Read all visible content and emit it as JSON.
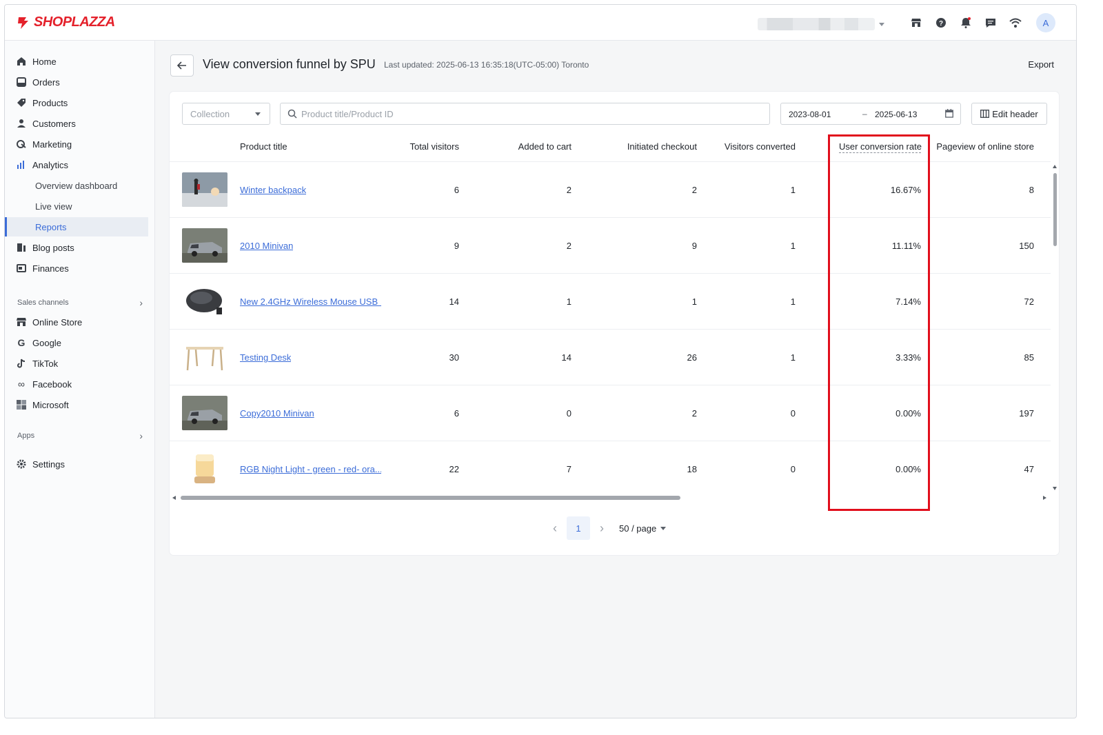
{
  "brand": {
    "name": "SHOPLAZZA",
    "color": "#e4212b"
  },
  "topbar": {
    "icons": [
      "store-icon",
      "help-icon",
      "bell-icon",
      "chat-icon",
      "wifi-icon"
    ],
    "avatar_letter": "A"
  },
  "sidebar": {
    "items": [
      {
        "label": "Home",
        "icon": "home-icon"
      },
      {
        "label": "Orders",
        "icon": "orders-icon"
      },
      {
        "label": "Products",
        "icon": "tag-icon"
      },
      {
        "label": "Customers",
        "icon": "person-icon"
      },
      {
        "label": "Marketing",
        "icon": "marketing-icon"
      },
      {
        "label": "Analytics",
        "icon": "bar-chart-icon"
      }
    ],
    "analytics_sub": [
      {
        "label": "Overview dashboard"
      },
      {
        "label": "Live view"
      },
      {
        "label": "Reports",
        "active": true
      }
    ],
    "items2": [
      {
        "label": "Blog posts",
        "icon": "blog-icon"
      },
      {
        "label": "Finances",
        "icon": "finance-icon"
      }
    ],
    "sales_channels_label": "Sales channels",
    "channels": [
      {
        "label": "Online Store",
        "icon": "store-icon"
      },
      {
        "label": "Google",
        "icon": "google-icon"
      },
      {
        "label": "TikTok",
        "icon": "tiktok-icon"
      },
      {
        "label": "Facebook",
        "icon": "meta-icon"
      },
      {
        "label": "Microsoft",
        "icon": "microsoft-icon"
      }
    ],
    "apps_label": "Apps",
    "settings_label": "Settings"
  },
  "header": {
    "title": "View conversion funnel by SPU",
    "last_updated": "Last updated: 2025-06-13 16:35:18(UTC-05:00) Toronto",
    "export_label": "Export"
  },
  "filters": {
    "collection_placeholder": "Collection",
    "search_placeholder": "Product title/Product ID",
    "date_start": "2023-08-01",
    "date_sep": "–",
    "date_end": "2025-06-13",
    "edit_header_label": "Edit header"
  },
  "table": {
    "columns": [
      "Product title",
      "Total visitors",
      "Added to cart",
      "Initiated checkout",
      "Visitors converted",
      "User conversion rate",
      "Pageview of online store"
    ],
    "rows": [
      {
        "title": "Winter backpack",
        "thumb": "winter-backpack-thumbnail",
        "visitors": "6",
        "cart": "2",
        "checkout": "2",
        "converted": "1",
        "rate": "16.67%",
        "pageviews": "8"
      },
      {
        "title": "2010 Minivan",
        "thumb": "minivan-thumbnail",
        "visitors": "9",
        "cart": "2",
        "checkout": "9",
        "converted": "1",
        "rate": "11.11%",
        "pageviews": "150"
      },
      {
        "title": "New 2.4GHz Wireless Mouse USB ...",
        "thumb": "wireless-mouse-thumbnail",
        "visitors": "14",
        "cart": "1",
        "checkout": "1",
        "converted": "1",
        "rate": "7.14%",
        "pageviews": "72"
      },
      {
        "title": "Testing Desk",
        "thumb": "desk-thumbnail",
        "visitors": "30",
        "cart": "14",
        "checkout": "26",
        "converted": "1",
        "rate": "3.33%",
        "pageviews": "85"
      },
      {
        "title": "Copy2010 Minivan",
        "thumb": "minivan-thumbnail",
        "visitors": "6",
        "cart": "0",
        "checkout": "2",
        "converted": "0",
        "rate": "0.00%",
        "pageviews": "197"
      },
      {
        "title": "RGB Night Light - green - red- ora...",
        "thumb": "night-light-thumbnail",
        "visitors": "22",
        "cart": "7",
        "checkout": "18",
        "converted": "0",
        "rate": "0.00%",
        "pageviews": "47"
      }
    ]
  },
  "pagination": {
    "current_page": "1",
    "page_size": "50 / page"
  },
  "colors": {
    "link": "#3b6cd8",
    "highlight": "#e10e1c"
  }
}
